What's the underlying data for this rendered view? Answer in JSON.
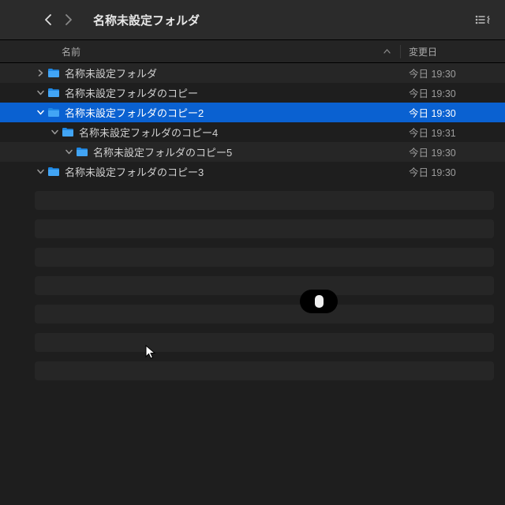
{
  "title": "名称未設定フォルダ",
  "columns": {
    "name": "名前",
    "modified": "変更日"
  },
  "rows": [
    {
      "indent": 0,
      "disclosure": "closed",
      "name": "名称未設定フォルダ",
      "date": "今日 19:30",
      "selected": false
    },
    {
      "indent": 0,
      "disclosure": "open",
      "name": "名称未設定フォルダのコピー",
      "date": "今日 19:30",
      "selected": false
    },
    {
      "indent": 0,
      "disclosure": "open",
      "name": "名称未設定フォルダのコピー2",
      "date": "今日 19:30",
      "selected": true
    },
    {
      "indent": 1,
      "disclosure": "open",
      "name": "名称未設定フォルダのコピー4",
      "date": "今日 19:31",
      "selected": false
    },
    {
      "indent": 2,
      "disclosure": "open",
      "name": "名称未設定フォルダのコピー5",
      "date": "今日 19:30",
      "selected": false
    },
    {
      "indent": 0,
      "disclosure": "open",
      "name": "名称未設定フォルダのコピー3",
      "date": "今日 19:30",
      "selected": false
    }
  ],
  "placeholder_rows": 7
}
